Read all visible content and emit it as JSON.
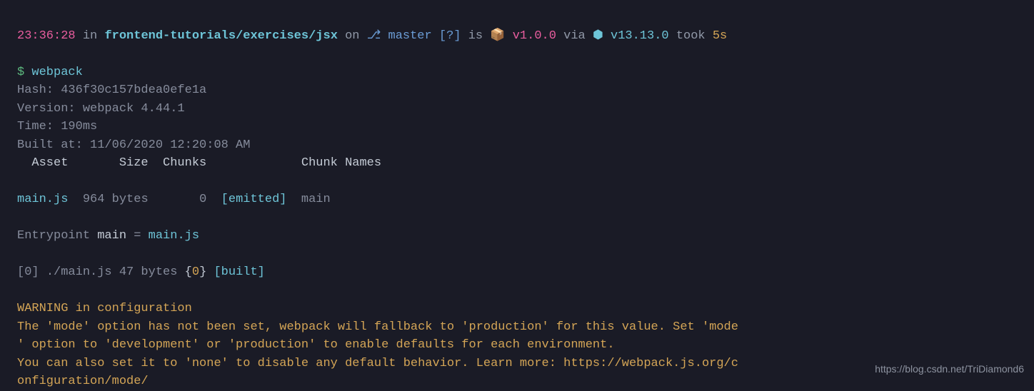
{
  "prompt": {
    "time": "23:36:28",
    "in": " in ",
    "path": "frontend-tutorials/exercises/jsx",
    "on": " on ",
    "branch_icon": "⎇ ",
    "branch": "master",
    "branch_status": " [?]",
    "is": " is ",
    "pkg_icon": "📦 ",
    "pkg_version": "v1.0.0",
    "via": " via ",
    "node_icon": "⬢ ",
    "node_version": "v13.13.0",
    "took": " took ",
    "duration": "5s"
  },
  "command": {
    "symbol": "$ ",
    "text": "webpack"
  },
  "output": {
    "hash": "Hash: 436f30c157bdea0efe1a",
    "version": "Version: webpack 4.44.1",
    "time": "Time: 190ms",
    "built_at": "Built at: 11/06/2020 12:20:08 AM",
    "table_header": "  Asset       Size  Chunks             Chunk Names",
    "asset_name": "main.js",
    "asset_rest": "  964 bytes       ",
    "asset_chunk": "0",
    "asset_emitted": "  [emitted]  ",
    "asset_chunkname": "main",
    "entrypoint_pre": "Entrypoint ",
    "entrypoint_main": "main",
    "entrypoint_eq": " = ",
    "entrypoint_file": "main.js",
    "module_pre": "[0] ",
    "module_path": "./main.js 47 bytes ",
    "module_brace_open": "{",
    "module_chunk": "0",
    "module_brace_close": "}",
    "module_built": " [built]"
  },
  "warning": {
    "title": "WARNING in configuration",
    "line1": "The 'mode' option has not been set, webpack will fallback to 'production' for this value. Set 'mode",
    "line2": "' option to 'development' or 'production' to enable defaults for each environment.",
    "line3": "You can also set it to 'none' to disable any default behavior. Learn more: https://webpack.js.org/c",
    "line4": "onfiguration/mode/"
  },
  "watermark": "https://blog.csdn.net/TriDiamond6"
}
